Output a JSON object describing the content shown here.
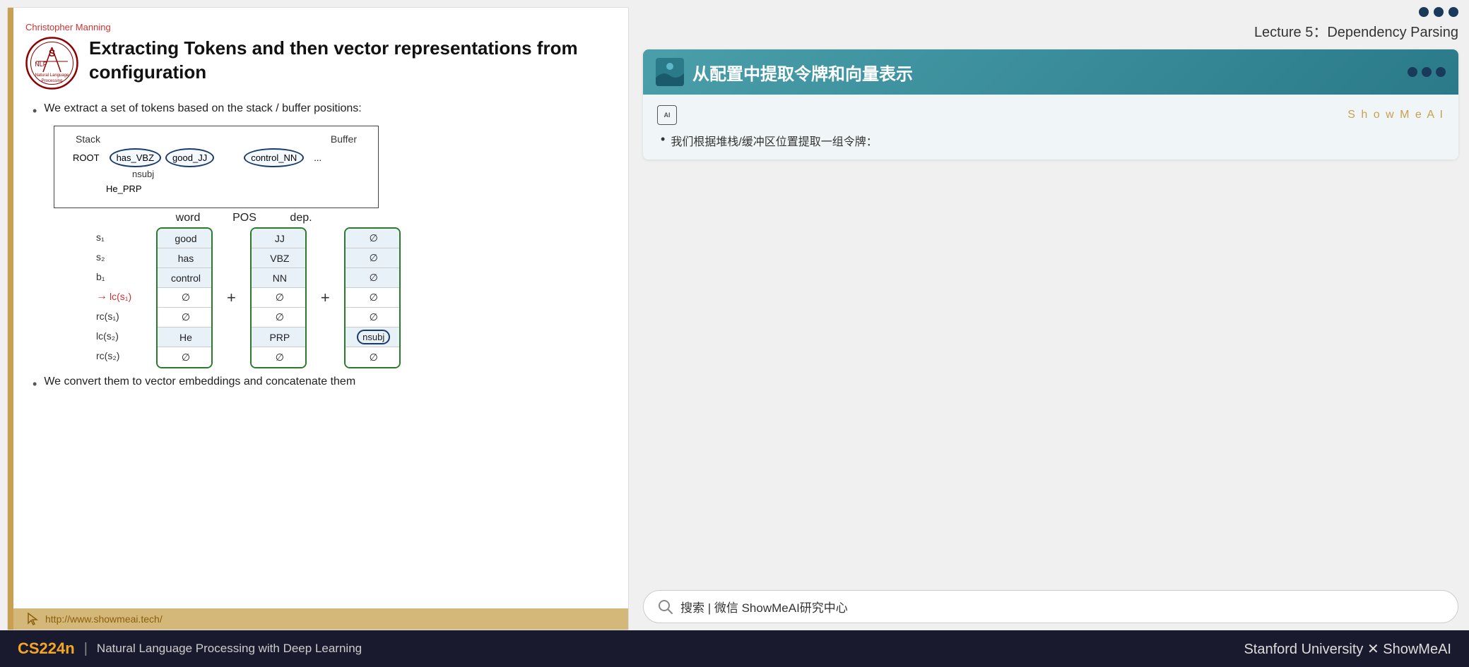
{
  "slide": {
    "author": "Christopher Manning",
    "title": "Extracting Tokens and then vector representations from configuration",
    "bullet1": "We extract a set of tokens based on the stack / buffer positions:",
    "bullet2": "We convert them to vector embeddings and concatenate them",
    "footer_link": "http://www.showmeai.tech/",
    "diagram": {
      "stack_label": "Stack",
      "buffer_label": "Buffer",
      "tokens": [
        "ROOT",
        "has_VBZ",
        "good_JJ",
        "control_NN",
        "..."
      ],
      "below_token": "He_PRP",
      "nsubj_label": "nsubj",
      "col_word": "word",
      "col_pos": "POS",
      "col_dep": "dep.",
      "rows": [
        {
          "label": "s₁",
          "word": "good",
          "pos": "JJ",
          "dep": "∅"
        },
        {
          "label": "s₂",
          "word": "has",
          "pos": "VBZ",
          "dep": "∅"
        },
        {
          "label": "b₁",
          "word": "control",
          "pos": "NN",
          "dep": "∅"
        },
        {
          "label": "lc(s₁)",
          "word": "∅",
          "pos": "∅",
          "dep": "∅",
          "arrow": true
        },
        {
          "label": "rc(s₁)",
          "word": "∅",
          "pos": "∅",
          "dep": "∅"
        },
        {
          "label": "lc(s₂)",
          "word": "He",
          "pos": "PRP",
          "dep": "nsubj"
        },
        {
          "label": "rc(s₂)",
          "word": "∅",
          "pos": "∅",
          "dep": "∅"
        }
      ]
    }
  },
  "right": {
    "lecture_title": "Lecture 5：Dependency Parsing",
    "card_title": "从配置中提取令牌和向量表示",
    "showmeai_label": "S h o w M e A I",
    "ai_icon": "AI",
    "translation_bullet": "我们根据堆栈/缓冲区位置提取一组令牌：",
    "search_text": "搜索 | 微信 ShowMeAI研究中心"
  },
  "bottom_bar": {
    "course": "CS224n",
    "separator": "|",
    "subtitle": "Natural Language Processing with Deep Learning",
    "right_text": "Stanford University  ✕  ShowMeAI"
  }
}
